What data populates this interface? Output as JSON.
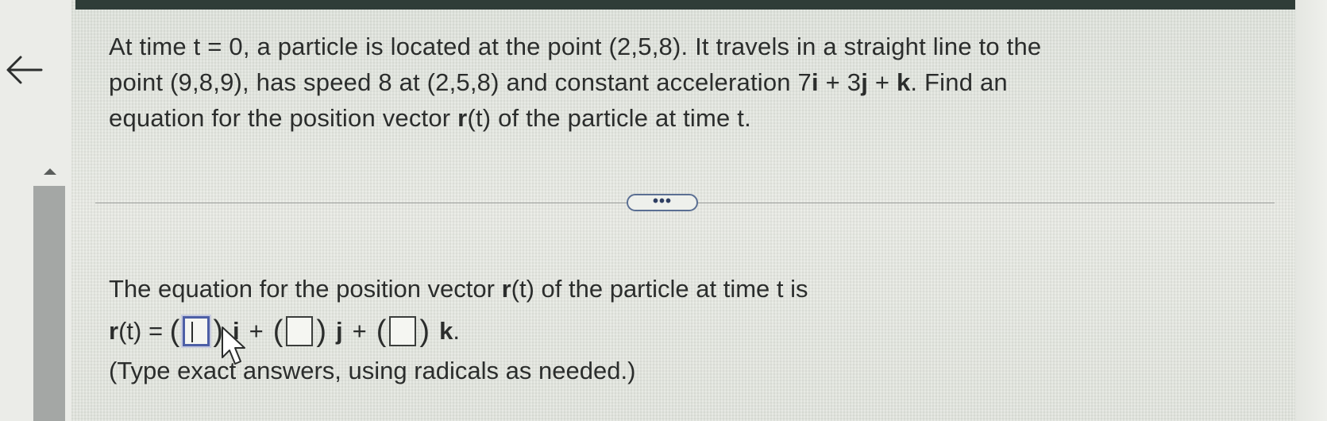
{
  "question": {
    "line1": "At time t = 0, a particle is located at the point (2,5,8). It travels in a straight line to the",
    "line2_pre": "point (9,8,9), has speed 8 at (2,5,8) and constant acceleration 7",
    "i": "i",
    "plus1": " + 3",
    "j": "j",
    "plus2": " + ",
    "k": "k",
    "line2_post": ". Find an",
    "line3_pre": "equation for the position vector ",
    "r": "r",
    "line3_post": "(t) of the particle at time t."
  },
  "more_button": {
    "label": "•••"
  },
  "answer": {
    "intro_pre": "The equation for the position vector ",
    "r": "r",
    "intro_post": "(t) of the particle at time t is",
    "lhs_r": "r",
    "lhs_rest": "(t) = ",
    "open_paren": "(",
    "close_paren": ")",
    "i": "i",
    "j": "j",
    "k": "k",
    "plus": "+",
    "period": ".",
    "box1_value": "",
    "box2_value": "",
    "box3_value": "",
    "note": "(Type exact answers, using radicals as needed.)"
  },
  "icons": {
    "back": "back-arrow-icon",
    "scroll_up": "scroll-up-icon",
    "cursor": "mouse-pointer-icon"
  },
  "colors": {
    "active_box": "#4d5fa6",
    "more_button_border": "#5b6f93"
  }
}
